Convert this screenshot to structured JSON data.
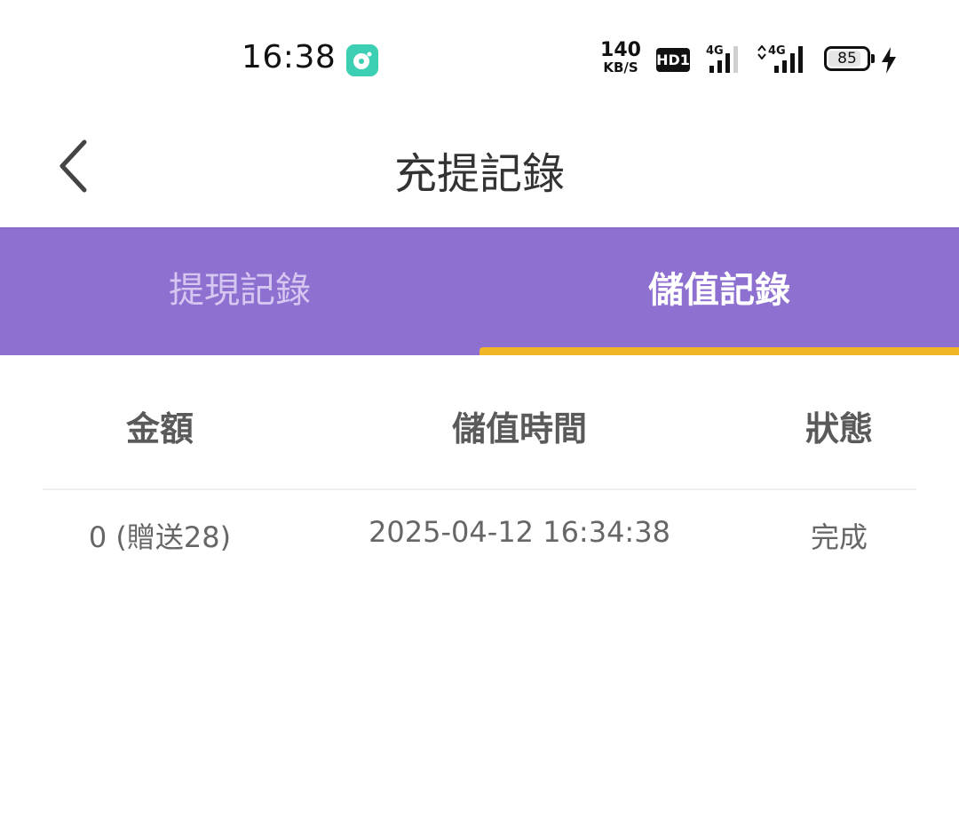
{
  "status_bar": {
    "time": "16:38",
    "net_speed_value": "140",
    "net_speed_unit": "KB/S",
    "hd_label": "HD1",
    "sim1_label": "4G",
    "sim2_label": "4G",
    "battery_percent": "85",
    "battery_level": 0.85,
    "app_badge_color": "#3ccfb4"
  },
  "header": {
    "title": "充提記錄"
  },
  "tabs": [
    {
      "label": "提現記錄",
      "active": false
    },
    {
      "label": "儲值記錄",
      "active": true
    }
  ],
  "table": {
    "columns": [
      "金額",
      "儲值時間",
      "狀態"
    ],
    "rows": [
      {
        "amount": "0 (贈送28)",
        "time": "2025-04-12 16:34:38",
        "status": "完成"
      }
    ]
  },
  "colors": {
    "tab_bar": "#8e70d0",
    "tab_indicator": "#f0b626",
    "tab_inactive_text": "#d6c7f1",
    "tab_active_text": "#ffffff"
  }
}
